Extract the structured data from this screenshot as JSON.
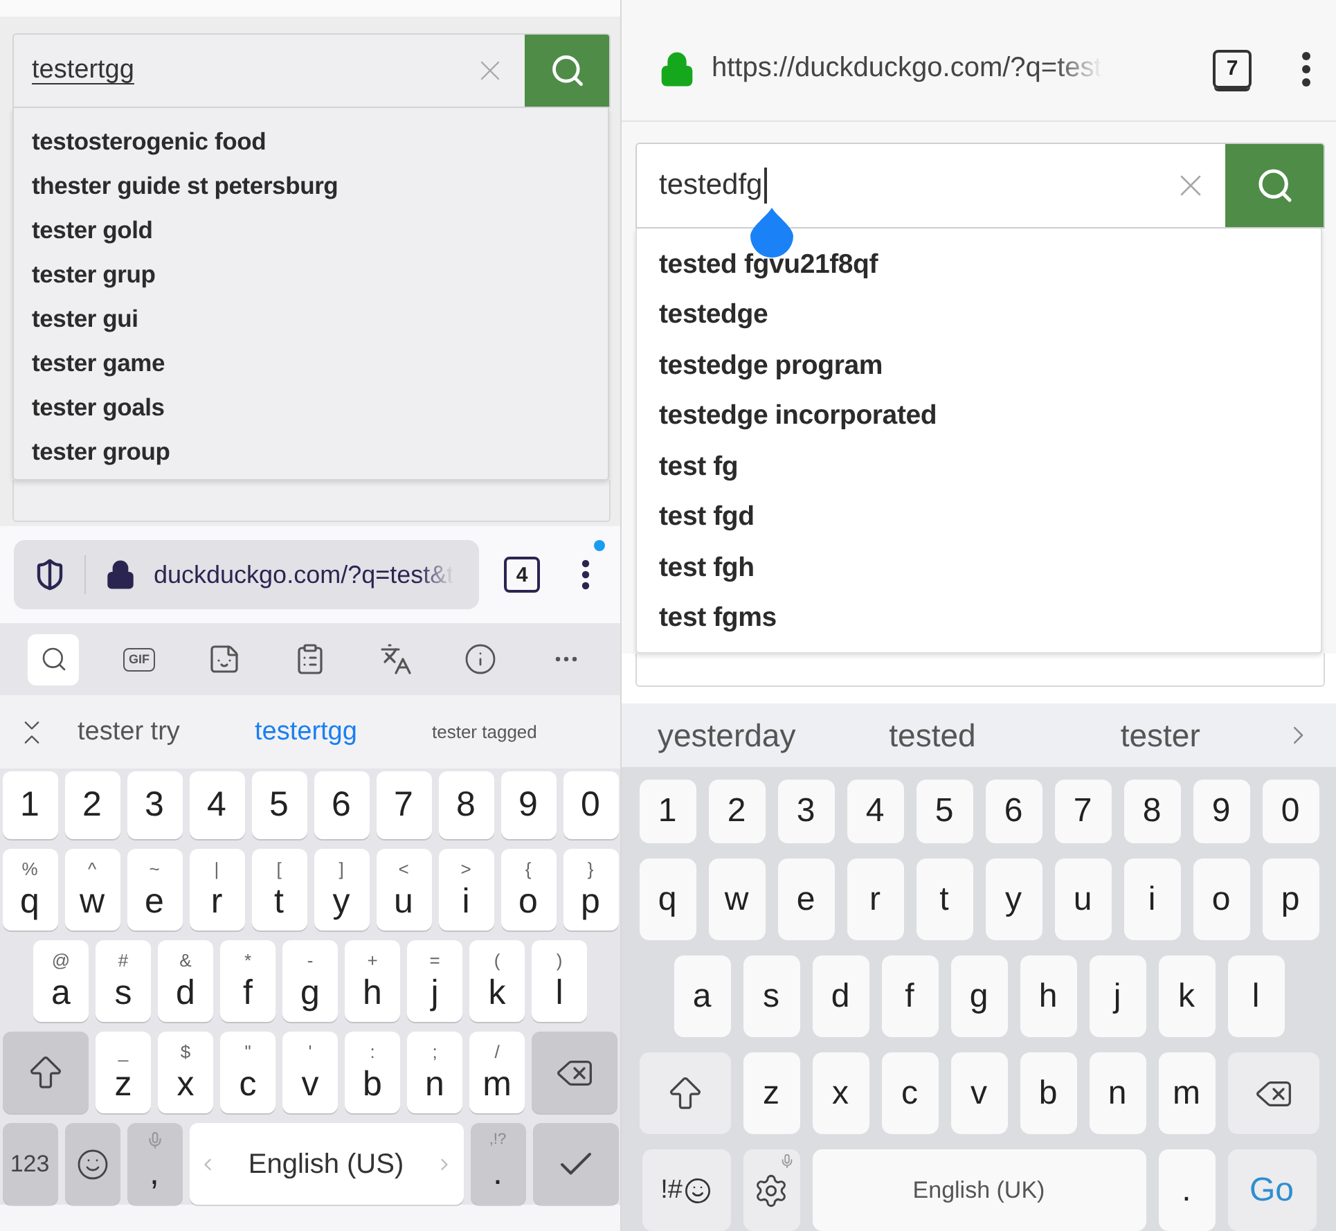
{
  "left_phone": {
    "search": {
      "value": "testertgg",
      "composing": true,
      "cursor": false
    },
    "suggestions": [
      "testosterogenic food",
      "thester guide st petersburg",
      "tester gold",
      "tester grup",
      "tester gui",
      "tester game",
      "tester goals",
      "tester group"
    ],
    "address_bar": {
      "url": "duckduckgo.com/?q=test&t",
      "tab_count": "4",
      "menu_dot": true
    },
    "keyboard_toolbar": [
      {
        "kind": "search",
        "selected": true
      },
      {
        "kind": "gif",
        "label": "GIF",
        "selected": false
      },
      {
        "kind": "sticker",
        "selected": false
      },
      {
        "kind": "clipboard",
        "selected": false
      },
      {
        "kind": "translate",
        "selected": false
      },
      {
        "kind": "info",
        "selected": false
      },
      {
        "kind": "more",
        "selected": false
      }
    ],
    "word_suggestions": [
      {
        "text": "tester try",
        "selected": false
      },
      {
        "text": "testertgg",
        "selected": true
      },
      {
        "text": "tester tagged",
        "selected": false
      }
    ],
    "keyboard": [
      [
        {
          "kind": "char",
          "label": "1"
        },
        {
          "kind": "char",
          "label": "2"
        },
        {
          "kind": "char",
          "label": "3"
        },
        {
          "kind": "char",
          "label": "4"
        },
        {
          "kind": "char",
          "label": "5"
        },
        {
          "kind": "char",
          "label": "6"
        },
        {
          "kind": "char",
          "label": "7"
        },
        {
          "kind": "char",
          "label": "8"
        },
        {
          "kind": "char",
          "label": "9"
        },
        {
          "kind": "char",
          "label": "0"
        }
      ],
      [
        {
          "kind": "char",
          "label": "q",
          "alt": "%"
        },
        {
          "kind": "char",
          "label": "w",
          "alt": "^"
        },
        {
          "kind": "char",
          "label": "e",
          "alt": "~"
        },
        {
          "kind": "char",
          "label": "r",
          "alt": "|"
        },
        {
          "kind": "char",
          "label": "t",
          "alt": "["
        },
        {
          "kind": "char",
          "label": "y",
          "alt": "]"
        },
        {
          "kind": "char",
          "label": "u",
          "alt": "<"
        },
        {
          "kind": "char",
          "label": "i",
          "alt": ">"
        },
        {
          "kind": "char",
          "label": "o",
          "alt": "{"
        },
        {
          "kind": "char",
          "label": "p",
          "alt": "}"
        }
      ],
      [
        {
          "kind": "char",
          "label": "a",
          "alt": "@"
        },
        {
          "kind": "char",
          "label": "s",
          "alt": "#"
        },
        {
          "kind": "char",
          "label": "d",
          "alt": "&"
        },
        {
          "kind": "char",
          "label": "f",
          "alt": "*"
        },
        {
          "kind": "char",
          "label": "g",
          "alt": "-"
        },
        {
          "kind": "char",
          "label": "h",
          "alt": "+"
        },
        {
          "kind": "char",
          "label": "j",
          "alt": "="
        },
        {
          "kind": "char",
          "label": "k",
          "alt": "("
        },
        {
          "kind": "char",
          "label": "l",
          "alt": ")"
        }
      ],
      [
        {
          "kind": "shift"
        },
        {
          "kind": "char",
          "label": "z",
          "alt": "_"
        },
        {
          "kind": "char",
          "label": "x",
          "alt": "$"
        },
        {
          "kind": "char",
          "label": "c",
          "alt": "\""
        },
        {
          "kind": "char",
          "label": "v",
          "alt": "'"
        },
        {
          "kind": "char",
          "label": "b",
          "alt": ":"
        },
        {
          "kind": "char",
          "label": "n",
          "alt": ";"
        },
        {
          "kind": "char",
          "label": "m",
          "alt": "/"
        },
        {
          "kind": "backspace"
        }
      ],
      [
        {
          "kind": "text",
          "label": "123"
        },
        {
          "kind": "emoji"
        },
        {
          "kind": "punct",
          "label": ",",
          "mic": true
        },
        {
          "kind": "space",
          "label": "English (US)"
        },
        {
          "kind": "punct",
          "label": ".",
          "alt": ",!?"
        },
        {
          "kind": "enter"
        }
      ]
    ]
  },
  "right_phone": {
    "address_bar": {
      "url": "https://duckduckgo.com/?q=test",
      "tab_count": "7"
    },
    "search": {
      "value": "testedfg",
      "composing": false,
      "cursor": true
    },
    "suggestions": [
      "tested fgvu21f8qf",
      "testedge",
      "testedge program",
      "testedge incorporated",
      "test fg",
      "test fgd",
      "test fgh",
      "test fgms"
    ],
    "word_suggestions": [
      {
        "text": "yesterday",
        "selected": false
      },
      {
        "text": "tested",
        "selected": false
      },
      {
        "text": "tester",
        "selected": false
      }
    ],
    "keyboard": [
      [
        {
          "kind": "char",
          "label": "1"
        },
        {
          "kind": "char",
          "label": "2"
        },
        {
          "kind": "char",
          "label": "3"
        },
        {
          "kind": "char",
          "label": "4"
        },
        {
          "kind": "char",
          "label": "5"
        },
        {
          "kind": "char",
          "label": "6"
        },
        {
          "kind": "char",
          "label": "7"
        },
        {
          "kind": "char",
          "label": "8"
        },
        {
          "kind": "char",
          "label": "9"
        },
        {
          "kind": "char",
          "label": "0"
        }
      ],
      [
        {
          "kind": "char",
          "label": "q"
        },
        {
          "kind": "char",
          "label": "w"
        },
        {
          "kind": "char",
          "label": "e"
        },
        {
          "kind": "char",
          "label": "r"
        },
        {
          "kind": "char",
          "label": "t"
        },
        {
          "kind": "char",
          "label": "y"
        },
        {
          "kind": "char",
          "label": "u"
        },
        {
          "kind": "char",
          "label": "i"
        },
        {
          "kind": "char",
          "label": "o"
        },
        {
          "kind": "char",
          "label": "p"
        }
      ],
      [
        {
          "kind": "char",
          "label": "a"
        },
        {
          "kind": "char",
          "label": "s"
        },
        {
          "kind": "char",
          "label": "d"
        },
        {
          "kind": "char",
          "label": "f"
        },
        {
          "kind": "char",
          "label": "g"
        },
        {
          "kind": "char",
          "label": "h"
        },
        {
          "kind": "char",
          "label": "j"
        },
        {
          "kind": "char",
          "label": "k"
        },
        {
          "kind": "char",
          "label": "l"
        }
      ],
      [
        {
          "kind": "shift"
        },
        {
          "kind": "char",
          "label": "z"
        },
        {
          "kind": "char",
          "label": "x"
        },
        {
          "kind": "char",
          "label": "c"
        },
        {
          "kind": "char",
          "label": "v"
        },
        {
          "kind": "char",
          "label": "b"
        },
        {
          "kind": "char",
          "label": "n"
        },
        {
          "kind": "char",
          "label": "m"
        },
        {
          "kind": "backspace"
        }
      ],
      [
        {
          "kind": "symbols",
          "label": "!#"
        },
        {
          "kind": "settings",
          "mic": true
        },
        {
          "kind": "space",
          "label": "English (UK)"
        },
        {
          "kind": "char",
          "label": "."
        },
        {
          "kind": "go",
          "label": "Go"
        }
      ]
    ]
  }
}
